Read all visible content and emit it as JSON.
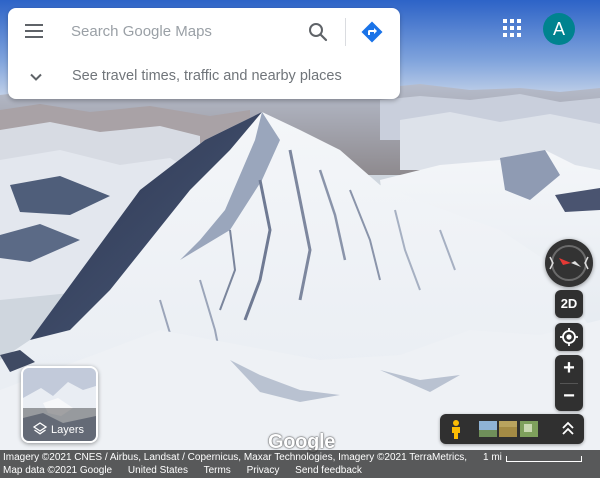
{
  "search": {
    "placeholder": "Search Google Maps",
    "hint": "See travel times, traffic and nearby places"
  },
  "account": {
    "initial": "A",
    "color": "#00838f"
  },
  "controls": {
    "mode_toggle": "2D",
    "zoom_in": "+",
    "zoom_out": "−"
  },
  "layers": {
    "label": "Layers"
  },
  "logo": {
    "text": "Google"
  },
  "footer": {
    "attribution": "Imagery ©2021 CNES / Airbus, Landsat / Copernicus, Maxar Technologies, Imagery ©2021 TerraMetrics,",
    "map_data": "Map data ©2021 Google",
    "region": "United States",
    "terms": "Terms",
    "privacy": "Privacy",
    "feedback": "Send feedback",
    "scale": "1 mi"
  },
  "icons": {
    "menu": "hamburger-icon",
    "search": "search-icon",
    "directions": "directions-icon",
    "chevron": "chevron-down-icon",
    "apps": "apps-grid-icon",
    "compass": "compass-icon",
    "location": "my-location-icon",
    "layers": "layers-icon",
    "pegman": "pegman-icon",
    "expand": "expand-icon"
  },
  "colors": {
    "accent": "#1a73e8",
    "control_bg": "#303030",
    "compass_red": "#e53935"
  }
}
